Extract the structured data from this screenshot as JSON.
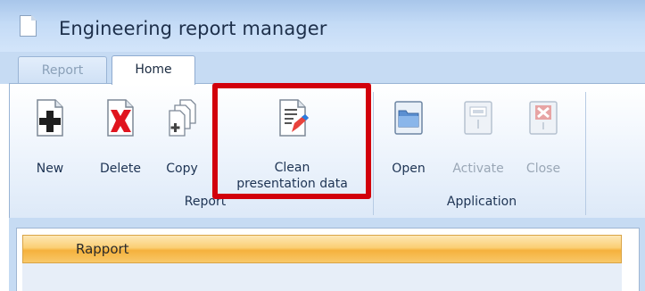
{
  "window": {
    "title": "Engineering report manager",
    "icon": "document-icon"
  },
  "tabs": [
    {
      "label": "Report",
      "active": false
    },
    {
      "label": "Home",
      "active": true
    }
  ],
  "ribbon": {
    "groups": [
      {
        "label": "Report",
        "buttons": [
          {
            "label": "New",
            "icon": "new-plus-icon",
            "enabled": true
          },
          {
            "label": "Delete",
            "icon": "delete-x-icon",
            "enabled": true
          },
          {
            "label": "Copy",
            "icon": "copy-documents-icon",
            "enabled": true
          },
          {
            "label_line1": "Clean",
            "label_line2": "presentation data",
            "icon": "clean-document-brush-icon",
            "enabled": true,
            "highlighted": true
          }
        ]
      },
      {
        "label": "Application",
        "buttons": [
          {
            "label": "Open",
            "icon": "open-folder-icon",
            "enabled": true
          },
          {
            "label": "Activate",
            "icon": "activate-icon",
            "enabled": false
          },
          {
            "label": "Close",
            "icon": "close-x-icon",
            "enabled": false
          }
        ]
      }
    ],
    "highlight_color": "#d2000b"
  },
  "grid": {
    "header": "Rapport",
    "header_color": "#fbcf74"
  }
}
